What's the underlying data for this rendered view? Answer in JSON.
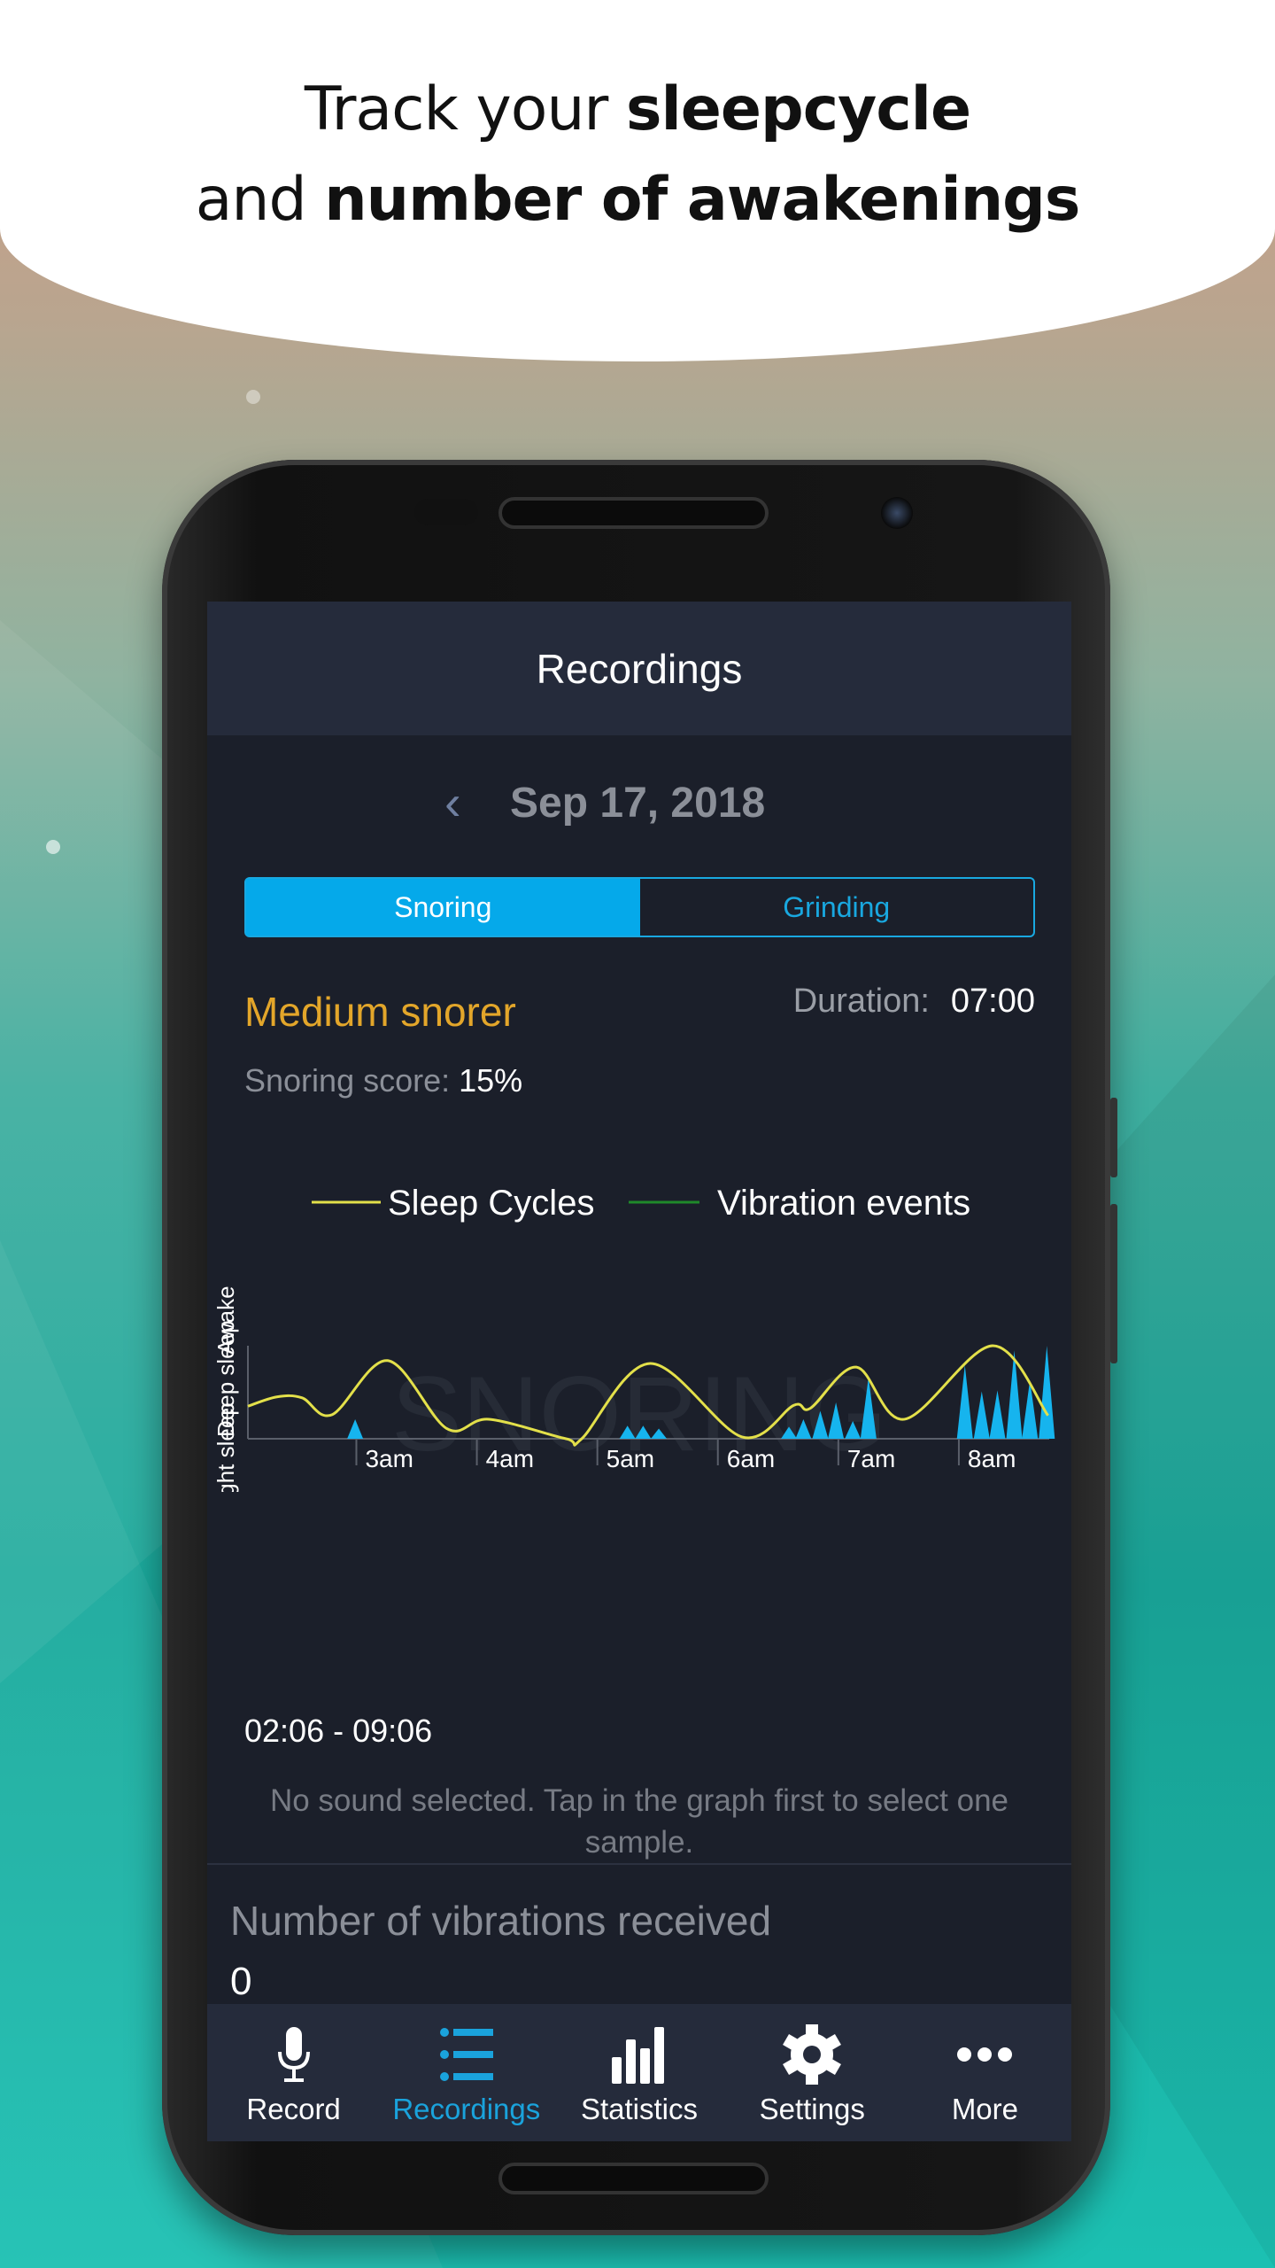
{
  "headline": {
    "line1_plain": "Track your ",
    "line1_bold": "sleepcycle",
    "line2_plain": "and ",
    "line2_bold": "number of awakenings"
  },
  "appbar": {
    "title": "Recordings"
  },
  "date_nav": {
    "prev_icon": "chevron-left-icon",
    "date": "Sep 17, 2018"
  },
  "tabs": [
    {
      "label": "Snoring",
      "active": true
    },
    {
      "label": "Grinding",
      "active": false
    }
  ],
  "summary": {
    "category": "Medium snorer",
    "duration_label": "Duration:",
    "duration_value": "07:00",
    "score_label": "Snoring score:",
    "score_value": "15%"
  },
  "colors": {
    "accent": "#05a9ea",
    "snorer": "#e3a62a",
    "sleep_line": "#e3e04a",
    "vibration_legend": "#1f8a2a",
    "vibration_fill": "#16b4ee"
  },
  "chart_data": {
    "type": "line",
    "watermark": "SNORING",
    "legend": [
      {
        "name": "Sleep Cycles",
        "color": "#e3e04a"
      },
      {
        "name": "Vibration events",
        "color": "#1f8a2a"
      }
    ],
    "legend_placement": "top",
    "y_tick_labels": [
      "Deep sleep",
      "Light sleep",
      "Awake"
    ],
    "ylim": [
      0,
      1
    ],
    "x_tick_labels": [
      "3am",
      "4am",
      "5am",
      "6am",
      "7am",
      "8am"
    ],
    "x_ticks": [
      3,
      4,
      5,
      6,
      7,
      8
    ],
    "xlim": [
      2.1,
      8.75
    ],
    "series": [
      {
        "name": "Sleep Cycles",
        "x": [
          2.1,
          2.34,
          2.55,
          2.8,
          3.26,
          3.75,
          4.1,
          4.74,
          4.87,
          5.44,
          6.2,
          6.63,
          6.77,
          7.15,
          7.55,
          8.28,
          8.74
        ],
        "values": [
          0.35,
          0.45,
          0.44,
          0.26,
          0.84,
          0.11,
          0.21,
          0,
          0,
          0.81,
          0.02,
          0.36,
          0.33,
          0.77,
          0.21,
          1.0,
          0.25
        ]
      },
      {
        "name": "Vibration events",
        "x": [
          2.99,
          5.25,
          5.38,
          5.51,
          6.59,
          6.71,
          6.85,
          6.98,
          7.12,
          7.25,
          8.05,
          8.19,
          8.32,
          8.46,
          8.59,
          8.73
        ],
        "values": [
          0.21,
          0.14,
          0.14,
          0.11,
          0.13,
          0.21,
          0.3,
          0.39,
          0.19,
          0.66,
          0.79,
          0.51,
          0.52,
          0.95,
          0.63,
          1.0
        ]
      }
    ]
  },
  "range": "02:06 - 09:06",
  "no_sound_message": "No sound selected. Tap in the graph first to select one sample.",
  "vibrations": {
    "label": "Number of vibrations received",
    "count": "0"
  },
  "nav": [
    {
      "label": "Record",
      "icon": "microphone-icon",
      "active": false
    },
    {
      "label": "Recordings",
      "icon": "list-icon",
      "active": true
    },
    {
      "label": "Statistics",
      "icon": "bar-chart-icon",
      "active": false
    },
    {
      "label": "Settings",
      "icon": "gear-icon",
      "active": false
    },
    {
      "label": "More",
      "icon": "more-dots-icon",
      "active": false
    }
  ]
}
